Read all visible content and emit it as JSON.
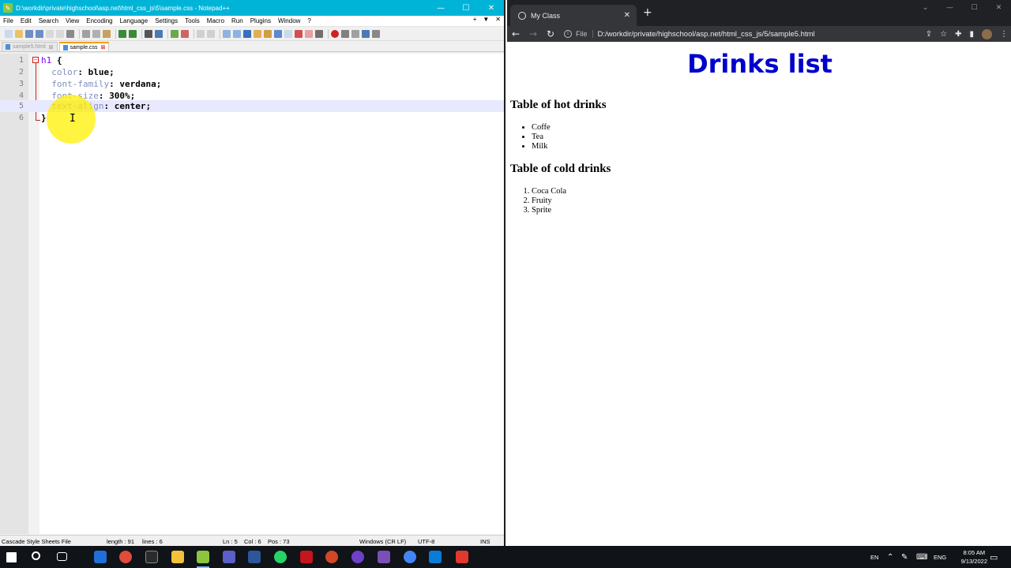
{
  "notepad": {
    "title": "D:\\workdir\\private\\highschool\\asp.net\\html_css_js\\5\\sample.css - Notepad++",
    "menu": [
      "File",
      "Edit",
      "Search",
      "View",
      "Encoding",
      "Language",
      "Settings",
      "Tools",
      "Macro",
      "Run",
      "Plugins",
      "Window",
      "?"
    ],
    "menu_right": [
      "+",
      "▼",
      "✕"
    ],
    "tabs": [
      {
        "label": "sample5.html",
        "active": false
      },
      {
        "label": "sample.css",
        "active": true
      }
    ],
    "lines": [
      {
        "n": "1",
        "selector": "h1",
        "brace": " {"
      },
      {
        "n": "2",
        "prop": "color",
        "value": "blue;"
      },
      {
        "n": "3",
        "prop": "font-family",
        "value": "verdana;"
      },
      {
        "n": "4",
        "prop": "font-size",
        "value": "300%;"
      },
      {
        "n": "5",
        "prop": "text-align",
        "value": "center;"
      },
      {
        "n": "6",
        "closing": "}"
      }
    ],
    "status": {
      "filetype": "Cascade Style Sheets File",
      "length": "length : 91",
      "lines": "lines : 6",
      "ln": "Ln : 5",
      "col": "Col : 6",
      "pos": "Pos : 73",
      "eol": "Windows (CR LF)",
      "encoding": "UTF-8",
      "mode": "INS"
    }
  },
  "browser": {
    "tab_title": "My Class",
    "file_label": "File",
    "url": "D:/workdir/private/highschool/asp.net/html_css_js/5/sample5.html",
    "page": {
      "heading": "Drinks list",
      "hot_title": "Table of hot drinks",
      "hot_items": [
        "Coffe",
        "Tea",
        "Milk"
      ],
      "cold_title": "Table of cold drinks",
      "cold_items": [
        "Coca Cola",
        "Fruity",
        "Sprite"
      ]
    }
  },
  "taskbar": {
    "lang_short": "EN",
    "lang": "ENG",
    "time": "8:05 AM",
    "date": "9/13/2022"
  },
  "colors": {
    "npp_title": "#00b4d8",
    "heading_blue": "#0000cc",
    "chrome_dark": "#202124"
  }
}
